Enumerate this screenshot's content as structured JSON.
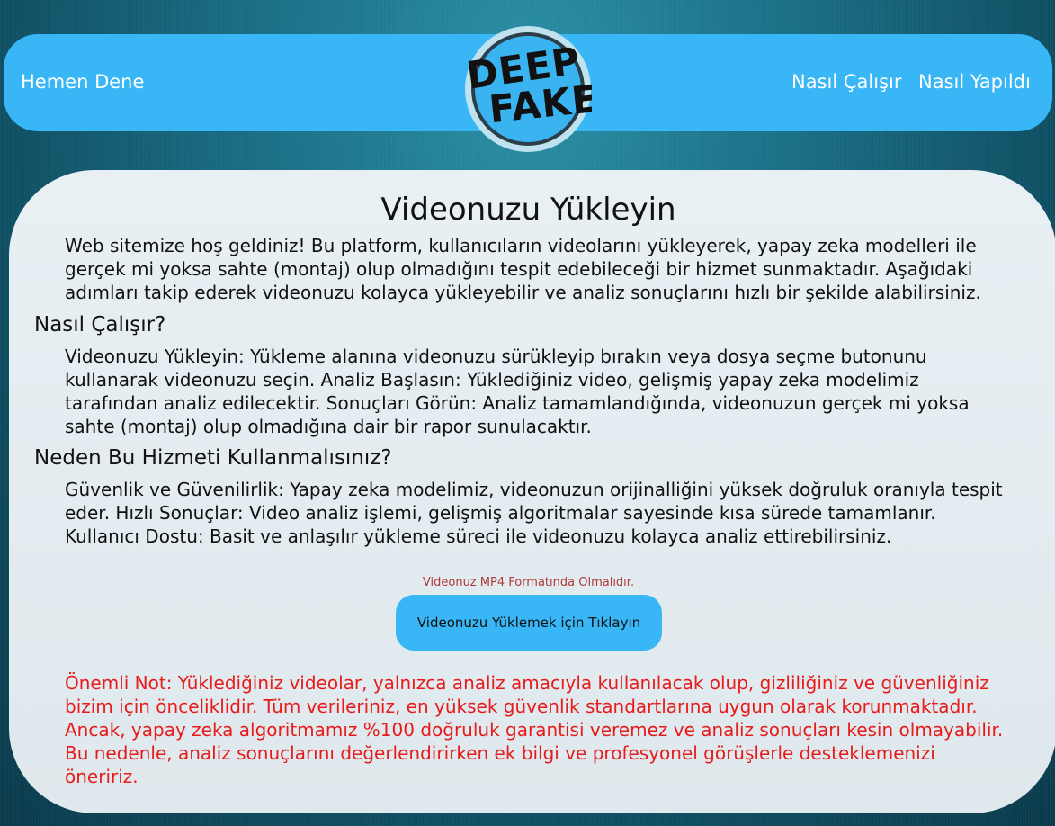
{
  "header": {
    "left_link": "Hemen Dene",
    "right_links": [
      "Nasıl Çalışır",
      "Nasıl Yapıldı"
    ],
    "logo_text": [
      "DEEP",
      "FAKE"
    ]
  },
  "main": {
    "title": "Videonuzu Yükleyin",
    "intro": "Web sitemize hoş geldiniz! Bu platform, kullanıcıların videolarını yükleyerek, yapay zeka modelleri ile gerçek mi yoksa sahte (montaj) olup olmadığını tespit edebileceği bir hizmet sunmaktadır. Aşağıdaki adımları takip ederek videonuzu kolayca yükleyebilir ve analiz sonuçlarını hızlı bir şekilde alabilirsiniz.",
    "how_heading": "Nasıl Çalışır?",
    "how_text": "Videonuzu Yükleyin: Yükleme alanına videonuzu sürükleyip bırakın veya dosya seçme butonunu kullanarak videonuzu seçin. Analiz Başlasın: Yüklediğiniz video, gelişmiş yapay zeka modelimiz tarafından analiz edilecektir. Sonuçları Görün: Analiz tamamlandığında, videonuzun gerçek mi yoksa sahte (montaj) olup olmadığına dair bir rapor sunulacaktır.",
    "why_heading": "Neden Bu Hizmeti Kullanmalısınız?",
    "why_text": "Güvenlik ve Güvenilirlik: Yapay zeka modelimiz, videonuzun orijinalliğini yüksek doğruluk oranıyla tespit eder. Hızlı Sonuçlar: Video analiz işlemi, gelişmiş algoritmalar sayesinde kısa sürede tamamlanır. Kullanıcı Dostu: Basit ve anlaşılır yükleme süreci ile videonuzu kolayca analiz ettirebilirsiniz.",
    "format_note": "Videonuz MP4 Formatında Olmalıdır.",
    "upload_button": "Videonuzu Yüklemek için Tıklayın",
    "warning": "Önemli Not: Yüklediğiniz videolar, yalnızca analiz amacıyla kullanılacak olup, gizliliğiniz ve güvenliğiniz bizim için önceliklidir. Tüm verileriniz, en yüksek güvenlik standartlarına uygun olarak korunmaktadır. Ancak, yapay zeka algoritmamız %100 doğruluk garantisi veremez ve analiz sonuçları kesin olmayabilir. Bu nedenle, analiz sonuçlarını değerlendirirken ek bilgi ve profesyonel görüşlerle desteklemenizi öneririz."
  },
  "colors": {
    "accent": "#38b6f5",
    "warning": "#e81a1a",
    "format_note": "#b03a3a"
  }
}
